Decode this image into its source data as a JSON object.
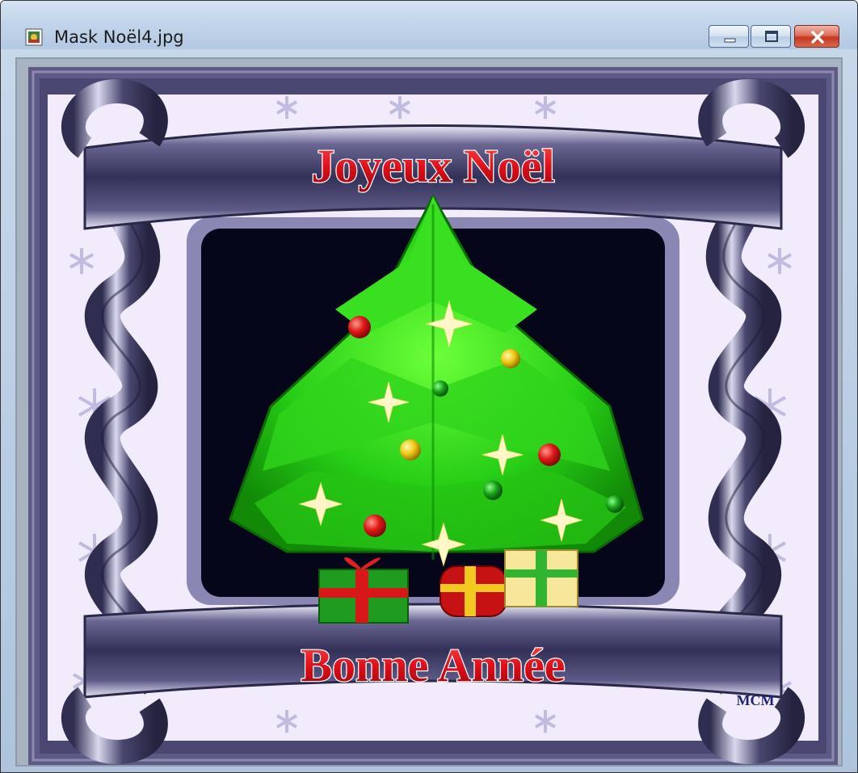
{
  "window": {
    "title": "Mask Noël4.jpg",
    "icons": {
      "app": "image-file-icon",
      "minimize": "minimize-icon",
      "maximize": "maximize-icon",
      "close": "close-icon"
    }
  },
  "image": {
    "greeting_top": "Joyeux Noël",
    "greeting_bottom": "Bonne Année",
    "signature": "MCM"
  },
  "colors": {
    "frame_purple": "#5d5a86",
    "ribbon_dark": "#3b3960",
    "ribbon_light": "#e6e6f5",
    "background_lavender": "#f1ebfb",
    "inner_black": "#06061a",
    "text_red": "#e2141e",
    "tree_green": "#22cc14",
    "signature_blue": "#1a2380"
  }
}
